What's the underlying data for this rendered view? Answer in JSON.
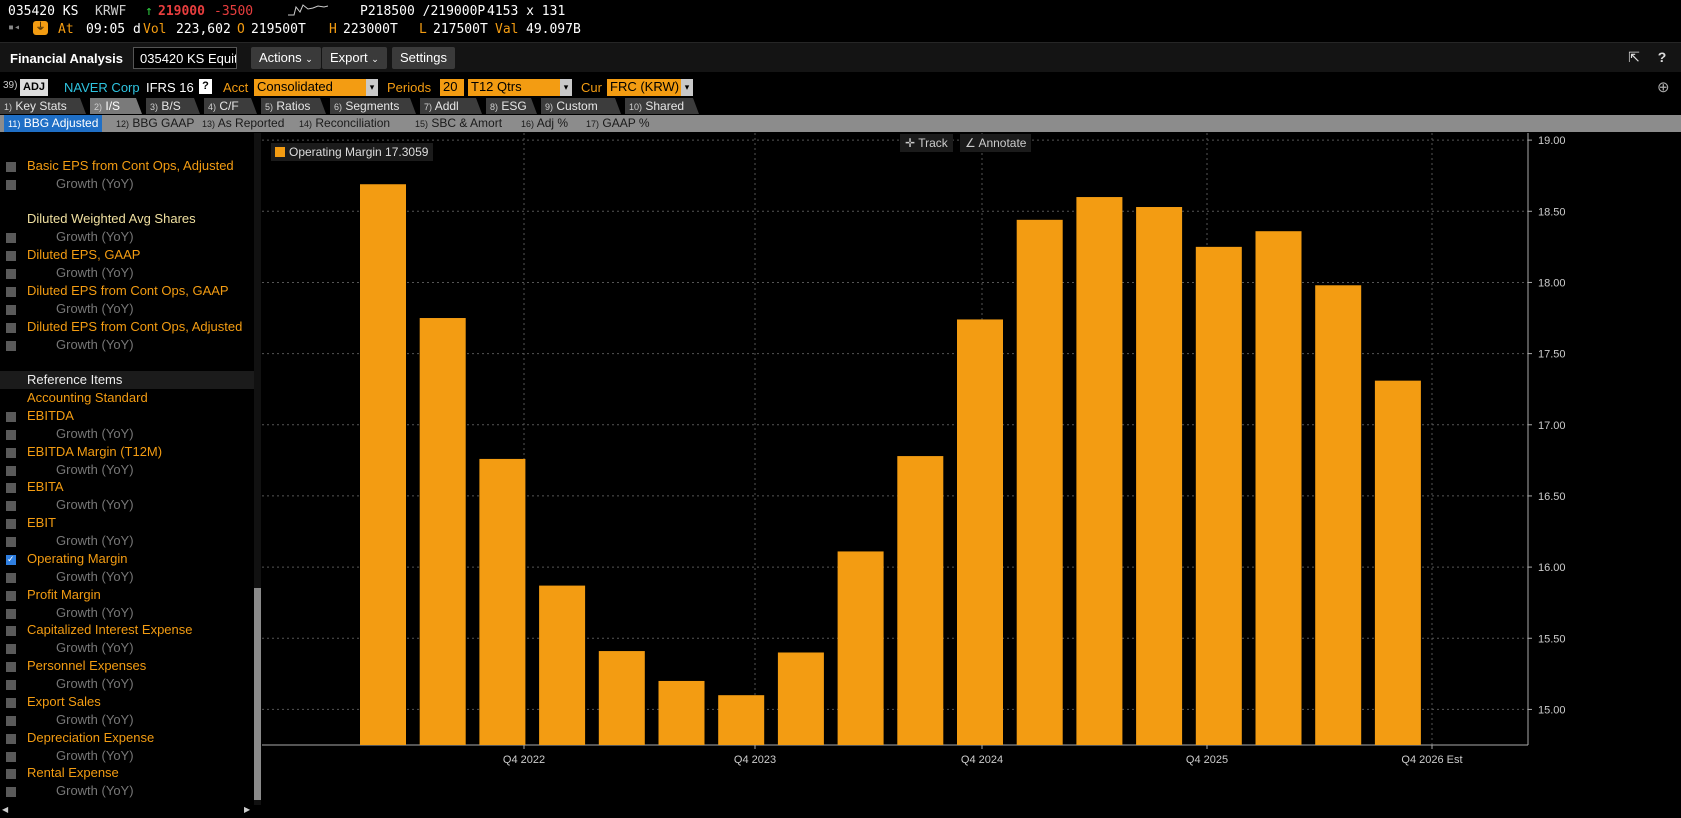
{
  "ticker": {
    "symbol": "035420 KS",
    "currency": "KRWF",
    "up_arrow": "↑",
    "last": "219000",
    "change": "-3500",
    "bid_ask": "P218500 /219000P",
    "size": "4153 x 131",
    "at_label": "At",
    "time": "09:05 d",
    "vol_label": "Vol",
    "vol": "223,602",
    "open_label": "O",
    "open": "219500T",
    "high_label": "H",
    "high": "223000T",
    "low_label": "L",
    "low": "217500T",
    "val_label": "Val",
    "val": "49.097B"
  },
  "titlebar": {
    "title": "Financial Analysis",
    "security": "035420 KS Equit",
    "actions": "Actions",
    "export": "Export",
    "settings": "Settings"
  },
  "params": {
    "num": "39)",
    "adj": "ADJ",
    "company": "NAVER Corp",
    "standard": "IFRS 16",
    "help": "?",
    "acct_label": "Acct",
    "acct": "Consolidated",
    "periods_label": "Periods",
    "periods_n": "20",
    "periods_type": "T12 Qtrs",
    "cur_label": "Cur",
    "cur": "FRC (KRW)"
  },
  "tabs": [
    {
      "num": "1)",
      "label": "Key Stats"
    },
    {
      "num": "2)",
      "label": "I/S"
    },
    {
      "num": "3)",
      "label": "B/S"
    },
    {
      "num": "4)",
      "label": "C/F"
    },
    {
      "num": "5)",
      "label": "Ratios"
    },
    {
      "num": "6)",
      "label": "Segments"
    },
    {
      "num": "7)",
      "label": "Addl"
    },
    {
      "num": "8)",
      "label": "ESG"
    },
    {
      "num": "9)",
      "label": "Custom"
    },
    {
      "num": "10)",
      "label": "Shared"
    }
  ],
  "subtabs": [
    {
      "num": "11)",
      "label": "BBG Adjusted"
    },
    {
      "num": "12)",
      "label": "BBG GAAP"
    },
    {
      "num": "13)",
      "label": "As Reported"
    },
    {
      "num": "14)",
      "label": "Reconciliation"
    },
    {
      "num": "15)",
      "label": "SBC & Amort"
    },
    {
      "num": "16)",
      "label": "Adj %"
    },
    {
      "num": "17)",
      "label": "GAAP %"
    }
  ],
  "left_panel": {
    "items": [
      "Basic EPS from Cont Ops, Adjusted",
      "Growth (YoY)",
      "Diluted Weighted Avg Shares",
      "Growth (YoY)",
      "Diluted EPS, GAAP",
      "Growth (YoY)",
      "Diluted EPS from Cont Ops, GAAP",
      "Growth (YoY)",
      "Diluted EPS from Cont Ops, Adjusted",
      "Growth (YoY)",
      "Reference Items",
      "Accounting Standard",
      "EBITDA",
      "Growth (YoY)",
      "EBITDA Margin (T12M)",
      "Growth (YoY)",
      "EBITA",
      "Growth (YoY)",
      "EBIT",
      "Growth (YoY)",
      "Operating Margin",
      "Growth (YoY)",
      "Profit Margin",
      "Growth (YoY)",
      "Capitalized Interest Expense",
      "Growth (YoY)",
      "Personnel Expenses",
      "Growth (YoY)",
      "Export Sales",
      "Growth (YoY)",
      "Depreciation Expense",
      "Growth (YoY)",
      "Rental Expense",
      "Growth (YoY)"
    ],
    "checked_item": "Operating Margin"
  },
  "chart_tools": {
    "track": "Track",
    "annotate": "Annotate"
  },
  "legend": {
    "label": "Operating Margin 17.3059"
  },
  "colors": {
    "bar": "#f39c12",
    "accent_orange": "#f39c12",
    "up_green": "#2ecc40",
    "down_red": "#e83e3e",
    "active_subtab": "#1f6fc6"
  },
  "chart_data": {
    "type": "bar",
    "title": "",
    "series": [
      {
        "name": "Operating Margin",
        "values": [
          18.69,
          17.75,
          16.76,
          15.87,
          15.41,
          15.2,
          15.1,
          15.4,
          16.11,
          16.78,
          17.74,
          18.44,
          18.6,
          18.53,
          18.25,
          18.36,
          17.98,
          17.31
        ]
      }
    ],
    "x_ticks": [
      "Q4 2022",
      "Q4 2023",
      "Q4 2024",
      "Q4 2025",
      "Q4 2026 Est"
    ],
    "y_ticks": [
      "15.00",
      "15.50",
      "16.00",
      "16.50",
      "17.00",
      "17.50",
      "18.00",
      "18.50",
      "19.00"
    ],
    "ylim": [
      14.75,
      19.05
    ],
    "grid": true,
    "legend_position": "top-left"
  }
}
